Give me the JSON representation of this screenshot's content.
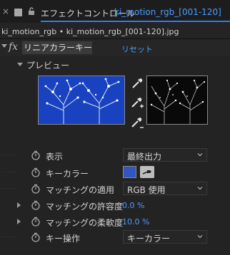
{
  "tab": {
    "close": "×",
    "prefix": "エフェクトコントロール",
    "file": "ki_motion_rgb_[001-120]"
  },
  "file_path": "ki_motion_rgb • ki_motion_rgb_[001-120].jpg",
  "effect": {
    "fx": "fx",
    "name": "リニアカラーキー",
    "reset": "リセット"
  },
  "preview": {
    "label": "プレビュー"
  },
  "properties": {
    "display": {
      "label": "表示",
      "value": "最終出力"
    },
    "key_color": {
      "label": "キーカラー",
      "swatch_color": "#3355c0"
    },
    "matching": {
      "label": "マッチングの適用",
      "value": "RGB 使用"
    },
    "tolerance": {
      "label": "マッチングの許容度",
      "value": "0.0 %"
    },
    "softness": {
      "label": "マッチングの柔軟度",
      "value": "10.0 %"
    },
    "key_operation": {
      "label": "キー操作",
      "value": "キーカラー"
    }
  },
  "colors": {
    "accent": "#4a9cff",
    "preview_background": "#1842bf",
    "key_swatch": "#3355c0"
  }
}
